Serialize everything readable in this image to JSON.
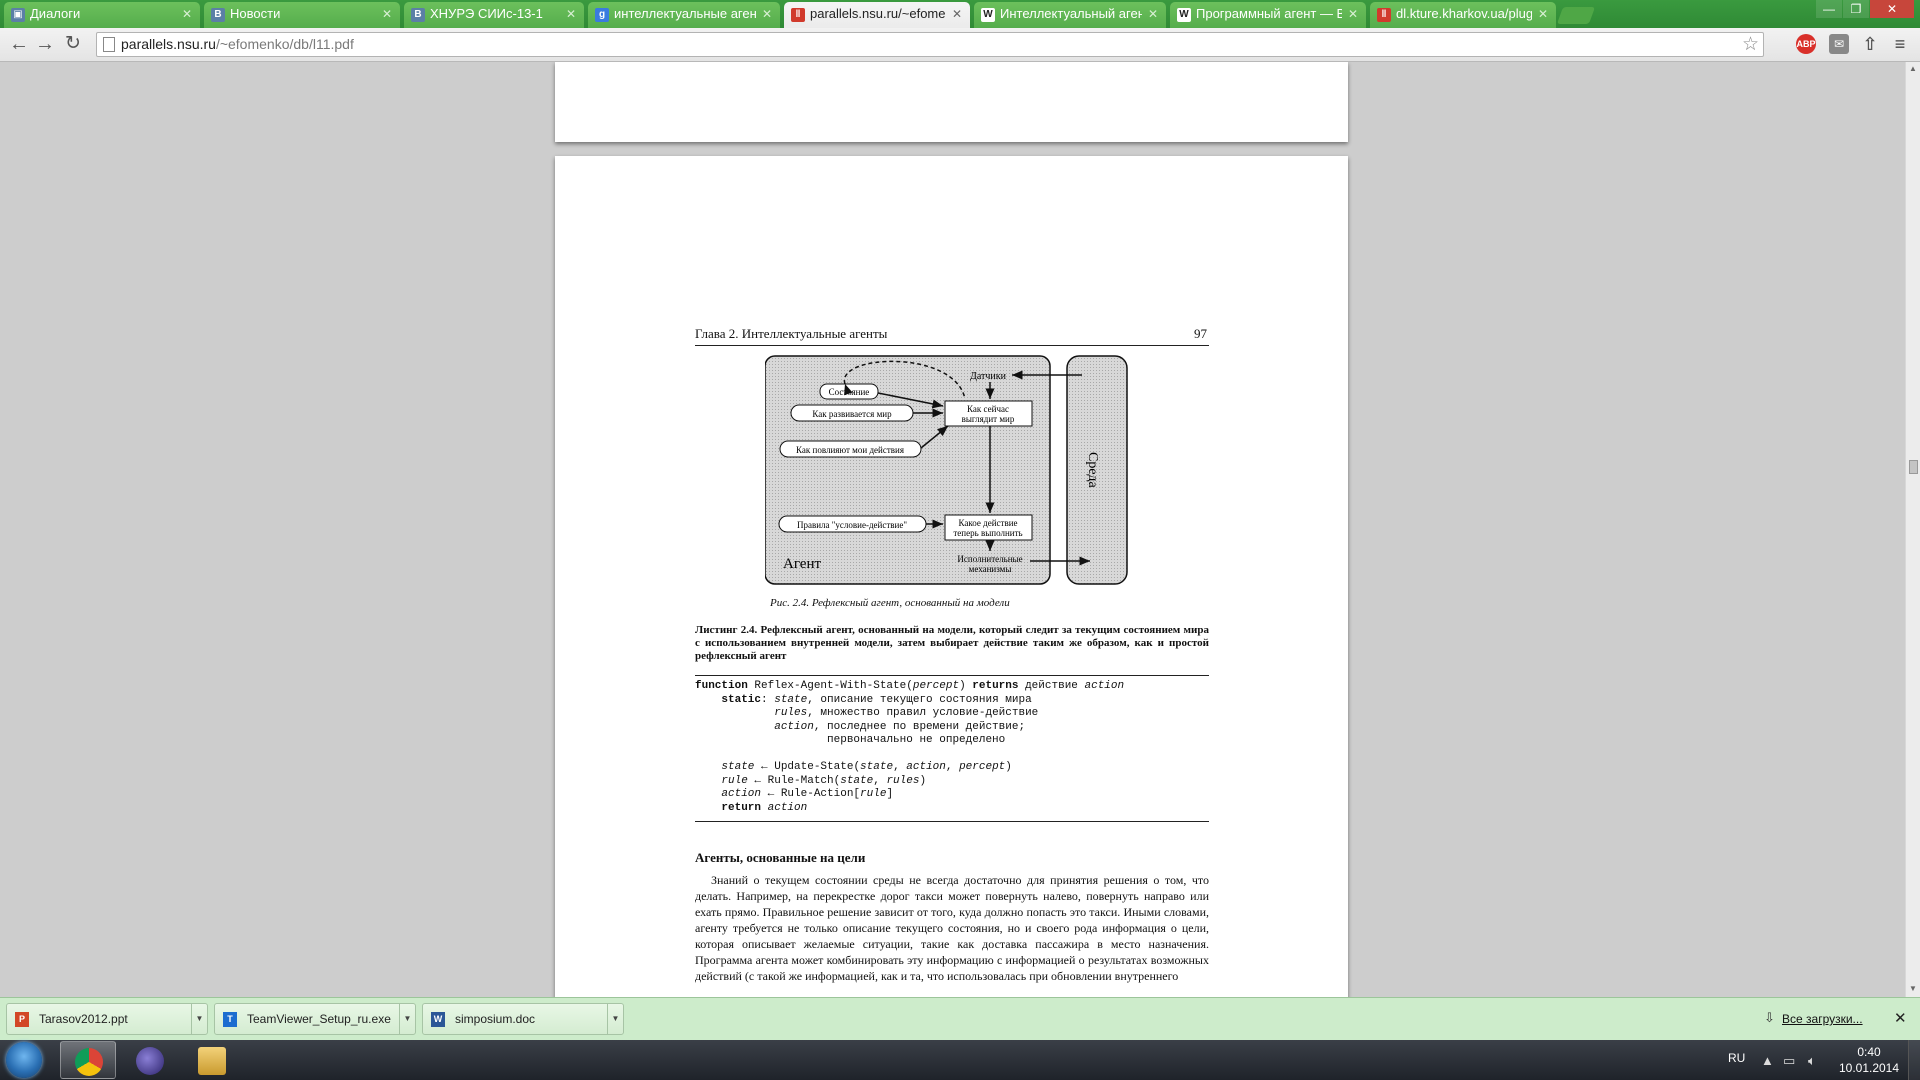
{
  "browser": {
    "tabs": [
      {
        "label": "Диалоги",
        "favicon": "vk-icon",
        "active": false
      },
      {
        "label": "Новости",
        "favicon": "vk-icon",
        "active": false
      },
      {
        "label": "ХНУРЭ СИИс-13-1",
        "favicon": "vk-icon",
        "active": false
      },
      {
        "label": "интеллектуальные агент",
        "favicon": "google-icon",
        "active": false
      },
      {
        "label": "parallels.nsu.ru/~efomenk",
        "favicon": "pdf-icon",
        "active": true
      },
      {
        "label": "Интеллектуальный агент",
        "favicon": "wikipedia-icon",
        "active": false
      },
      {
        "label": "Программный агент — В",
        "favicon": "wikipedia-icon",
        "active": false
      },
      {
        "label": "dl.kture.kharkov.ua/plugi",
        "favicon": "pdf-icon",
        "active": false
      }
    ],
    "url_host": "parallels.nsu.ru",
    "url_path": "/~efomenko/db/l11.pdf",
    "extensions": {
      "adblock": "ABP"
    }
  },
  "pdf": {
    "running_head": "Глава 2. Интеллектуальные агенты",
    "page_number": "97",
    "figure": {
      "agent_label": "Агент",
      "env_label": "Среда",
      "sensors": "Датчики",
      "state": "Состояние",
      "world_evolves": "Как развивается мир",
      "my_actions": "Как повлияют мои действия",
      "world_now_1": "Как сейчас",
      "world_now_2": "выглядит мир",
      "rules": "Правила \"условие-действие\"",
      "action_now_1": "Какое действие",
      "action_now_2": "теперь выполнить",
      "actuators_1": "Исполнительные",
      "actuators_2": "механизмы"
    },
    "figure_caption": "Рис. 2.4. Рефлексный агент, основанный на модели",
    "listing_title": "Листинг 2.4. Рефлексный агент, основанный на модели, который следит за текущим состоянием мира с использованием внутренней модели, затем выбирает действие таким же образом, как и простой рефлексный агент",
    "code": [
      {
        "indent": 0,
        "parts": [
          [
            "b",
            "function"
          ],
          [
            "t",
            " Reflex-Agent-With-State("
          ],
          [
            "i",
            "percept"
          ],
          [
            "t",
            ") "
          ],
          [
            "b",
            "returns"
          ],
          [
            "t",
            " действие "
          ],
          [
            "i",
            "action"
          ]
        ]
      },
      {
        "indent": 4,
        "parts": [
          [
            "b",
            "static"
          ],
          [
            "t",
            ": "
          ],
          [
            "i",
            "state"
          ],
          [
            "t",
            ", описание текущего состояния мира"
          ]
        ]
      },
      {
        "indent": 12,
        "parts": [
          [
            "i",
            "rules"
          ],
          [
            "t",
            ", множество правил условие-действие"
          ]
        ]
      },
      {
        "indent": 12,
        "parts": [
          [
            "i",
            "action"
          ],
          [
            "t",
            ", последнее по времени действие;"
          ]
        ]
      },
      {
        "indent": 20,
        "parts": [
          [
            "t",
            "первоначально не определено"
          ]
        ]
      },
      {
        "indent": 0,
        "parts": []
      },
      {
        "indent": 4,
        "parts": [
          [
            "i",
            "state"
          ],
          [
            "t",
            " ← Update-State("
          ],
          [
            "i",
            "state"
          ],
          [
            "t",
            ", "
          ],
          [
            "i",
            "action"
          ],
          [
            "t",
            ", "
          ],
          [
            "i",
            "percept"
          ],
          [
            "t",
            ")"
          ]
        ]
      },
      {
        "indent": 4,
        "parts": [
          [
            "i",
            "rule"
          ],
          [
            "t",
            " ← Rule-Match("
          ],
          [
            "i",
            "state"
          ],
          [
            "t",
            ", "
          ],
          [
            "i",
            "rules"
          ],
          [
            "t",
            ")"
          ]
        ]
      },
      {
        "indent": 4,
        "parts": [
          [
            "i",
            "action"
          ],
          [
            "t",
            " ← Rule-Action["
          ],
          [
            "i",
            "rule"
          ],
          [
            "t",
            "]"
          ]
        ]
      },
      {
        "indent": 4,
        "parts": [
          [
            "b",
            "return"
          ],
          [
            "t",
            " "
          ],
          [
            "i",
            "action"
          ]
        ]
      }
    ],
    "section_title": "Агенты, основанные на цели",
    "body": "Знаний о текущем состоянии среды не всегда достаточно для принятия решения о том, что делать. Например, на перекрестке дорог такси может повернуть налево, повернуть направо или ехать прямо. Правильное решение зависит от того, куда должно попасть это такси. Иными словами, агенту требуется не только описание текущего состояния, но и своего рода информация о цели, которая описывает желаемые ситуации, такие как доставка пассажира в место назначения. Программа агента может комбинировать эту информацию с информацией о результатах возможных действий (с такой же информацией, как и та, что использовалась при обновлении внутреннего"
  },
  "downloads": {
    "items": [
      {
        "name": "Tarasov2012.ppt",
        "icon": "ppt-icon"
      },
      {
        "name": "TeamViewer_Setup_ru.exe",
        "icon": "exe-icon"
      },
      {
        "name": "simposium.doc",
        "icon": "doc-icon"
      }
    ],
    "show_all": "Все загрузки..."
  },
  "taskbar": {
    "language": "RU",
    "time": "0:40",
    "date": "10.01.2014"
  }
}
